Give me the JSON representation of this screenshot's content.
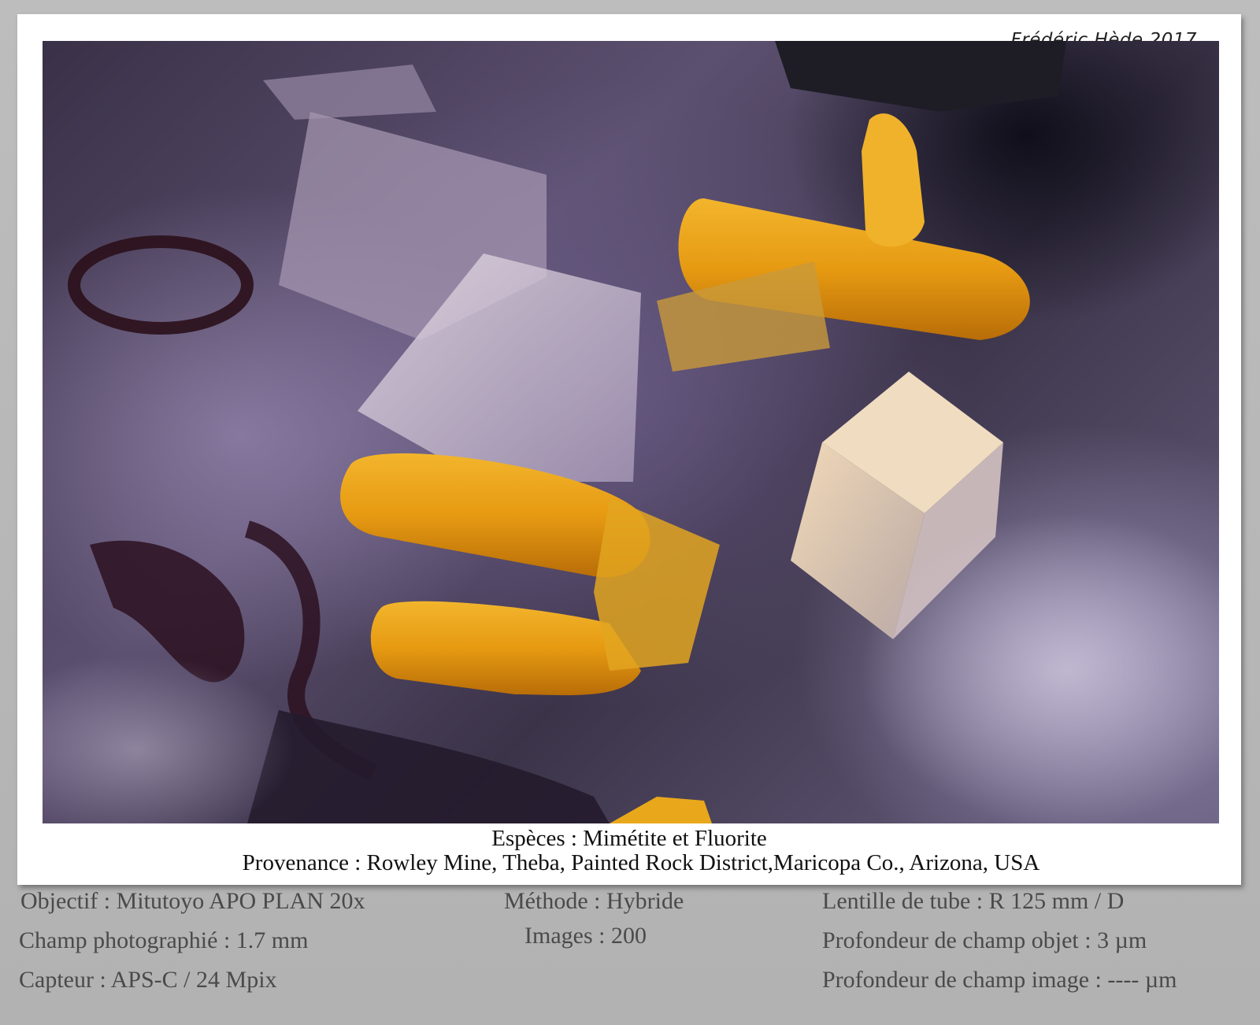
{
  "signature": "Frédéric Hède 2017",
  "caption": {
    "species": "Espèces : Mimétite et Fluorite",
    "provenance": "Provenance : Rowley Mine, Theba, Painted Rock District,Maricopa Co., Arizona, USA"
  },
  "details": {
    "objectif": "Objectif : Mitutoyo APO PLAN 20x",
    "champ": "Champ photographié : 1.7 mm",
    "capteur": "Capteur : APS-C / 24 Mpix",
    "methode": "Méthode : Hybride",
    "images": "Images : 200",
    "lentille": "Lentille de tube : R 125 mm / D",
    "prof_objet": "Profondeur de champ objet : 3 µm",
    "prof_image": "Profondeur de champ image : ---- µm"
  },
  "colors": {
    "mimetite": "#e8a21a",
    "fluorite": "#cfc8dc",
    "background": "#b7b7b7"
  }
}
